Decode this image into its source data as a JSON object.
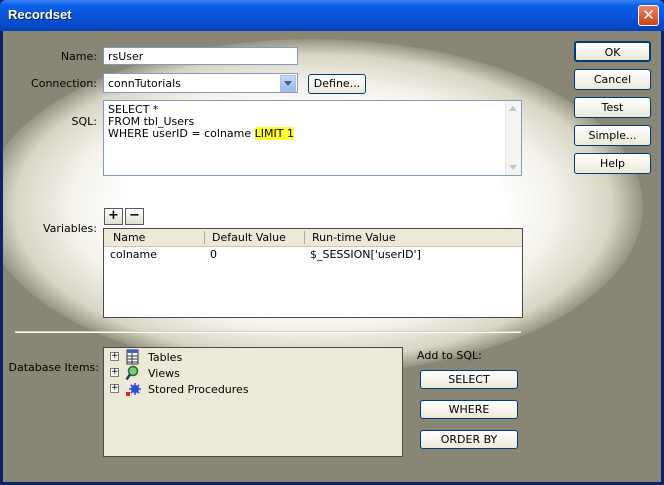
{
  "window": {
    "title": "Recordset",
    "close_glyph": "✕"
  },
  "form": {
    "name_label": "Name:",
    "name_value": "rsUser",
    "connection_label": "Connection:",
    "connection_value": "connTutorials",
    "define_label": "Define...",
    "sql_label": "SQL:",
    "sql_lines": [
      "SELECT *",
      "FROM tbl_Users",
      "WHERE userID = colname "
    ],
    "sql_highlight": "LIMIT 1",
    "variables_label": "Variables:",
    "plus": "+",
    "minus": "−"
  },
  "variables_table": {
    "columns": [
      "Name",
      "Default Value",
      "Run-time Value"
    ],
    "rows": [
      {
        "name": "colname",
        "default": "0",
        "runtime": "$_SESSION['userID']"
      }
    ]
  },
  "database": {
    "label": "Database Items:",
    "items": [
      {
        "label": "Tables",
        "icon": "tables-icon"
      },
      {
        "label": "Views",
        "icon": "views-icon"
      },
      {
        "label": "Stored Procedures",
        "icon": "stored-procedures-icon"
      }
    ],
    "expander": "+"
  },
  "add_to_sql": {
    "label": "Add to SQL:",
    "select": "SELECT",
    "where": "WHERE",
    "order_by": "ORDER BY"
  },
  "side_buttons": {
    "ok": "OK",
    "cancel": "Cancel",
    "test": "Test",
    "simple": "Simple...",
    "help": "Help"
  },
  "colors": {
    "highlight": "#ffff33",
    "title_bar": "#0854d8",
    "dialog_bg": "#8a8676"
  }
}
